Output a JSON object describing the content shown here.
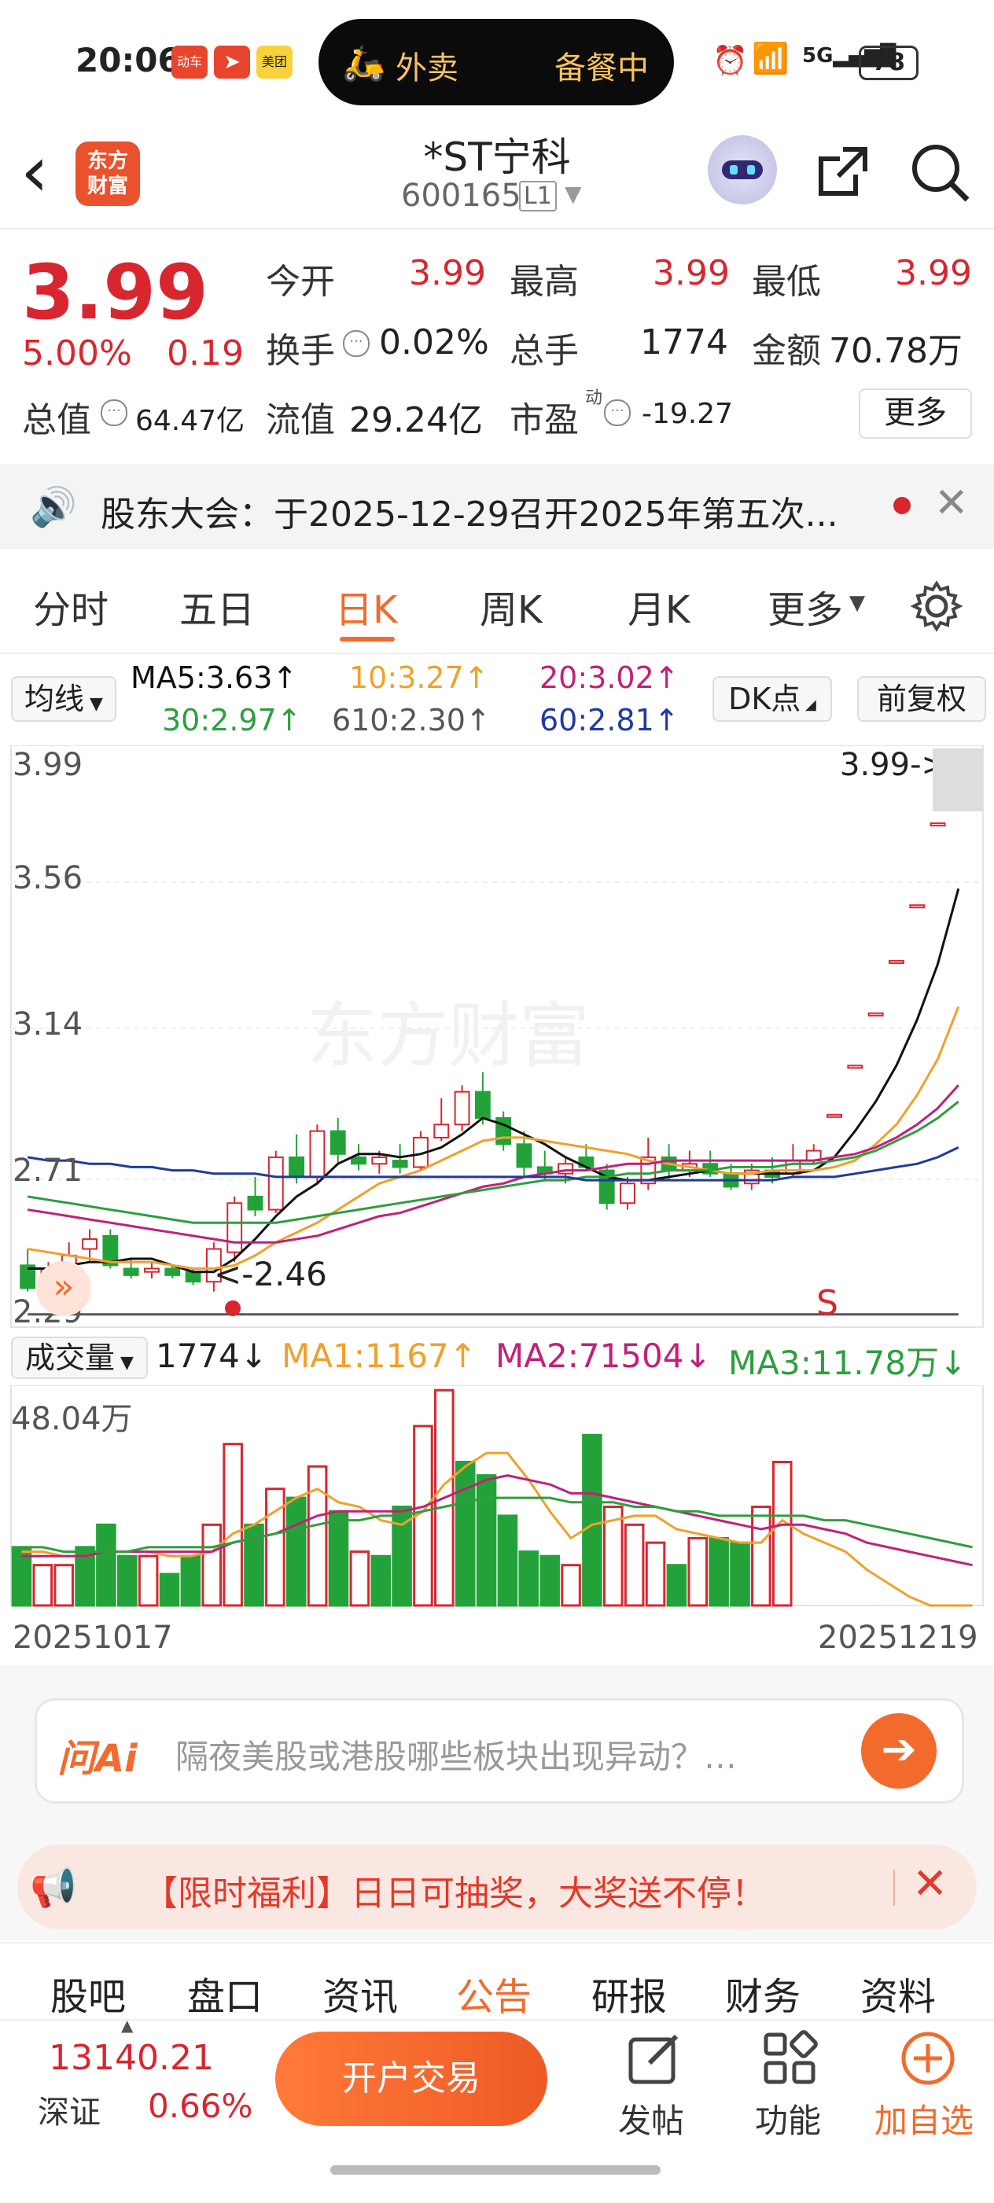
{
  "status": {
    "time": "20:06",
    "pill_left": "外卖",
    "pill_right": "备餐中",
    "battery": "78",
    "app_badges": [
      "动车",
      "",
      "美团"
    ]
  },
  "header": {
    "logo_text": "东方\n财富",
    "title": "*ST宁科",
    "code": "600165",
    "level": "L1"
  },
  "quote": {
    "price": "3.99",
    "change_pct": "5.00%",
    "change": "0.19",
    "open_label": "今开",
    "open": "3.99",
    "high_label": "最高",
    "high": "3.99",
    "low_label": "最低",
    "low": "3.99",
    "turnover_label": "换手",
    "turnover": "0.02%",
    "vol_label": "总手",
    "vol": "1774",
    "amount_label": "金额",
    "amount": "70.78万",
    "mktcap_label": "总值",
    "mktcap": "64.47亿",
    "float_label": "流值",
    "float_cap": "29.24亿",
    "pe_label": "市盈",
    "pe_sup": "动",
    "pe": "-19.27",
    "more": "更多"
  },
  "notice": {
    "text": "股东大会：于2025-12-29召开2025年第五次..."
  },
  "tabs": [
    "分时",
    "五日",
    "日K",
    "周K",
    "月K",
    "更多"
  ],
  "active_tab": "日K",
  "ma": {
    "chip": "均线",
    "ma5": "MA5:3.63↑",
    "ma10": "10:3.27↑",
    "ma20": "20:3.02↑",
    "ma30": "30:2.97↑",
    "ma610": "610:2.30↑",
    "ma60": "60:2.81↑",
    "dk": "DK点",
    "adj": "前复权"
  },
  "price_axis": [
    "3.99",
    "3.56",
    "3.14",
    "2.71",
    "2.29"
  ],
  "price_tag": "3.99->",
  "low_tag": "<-2.46",
  "signal": "S",
  "volume": {
    "chip": "成交量",
    "value": "1774↓",
    "ma1": "MA1:1167↑",
    "ma2": "MA2:71504↓",
    "ma3": "MA3:11.78万↓",
    "max_label": "48.04万"
  },
  "dates": {
    "start": "20251017",
    "end": "20251219"
  },
  "ai": {
    "placeholder": "隔夜美股或港股哪些板块出现异动？…",
    "logo": "问Ai"
  },
  "promo": {
    "text": "【限时福利】日日可抽奖，大奖送不停！"
  },
  "bottom_tabs": [
    "股吧",
    "盘口",
    "资讯",
    "公告",
    "研报",
    "财务",
    "资料"
  ],
  "active_bottom": "公告",
  "footer": {
    "index_value": "13140.21",
    "index_name": "深证",
    "index_change": "0.66%",
    "trade_button": "开户交易",
    "post": "发帖",
    "function": "功能",
    "add_watch": "加自选"
  },
  "colors": {
    "up": "#d8262f",
    "down": "#24a23a",
    "accent": "#f26b2c"
  },
  "chart_data": [
    {
      "type": "candlestick",
      "x_start": "20251017",
      "x_end": "20251219",
      "ylim": [
        2.29,
        3.99
      ],
      "y_ticks": [
        3.99,
        3.56,
        3.14,
        2.71,
        2.29
      ],
      "candles": [
        {
          "o": 2.45,
          "h": 2.5,
          "l": 2.37,
          "c": 2.38
        },
        {
          "o": 2.4,
          "h": 2.46,
          "l": 2.38,
          "c": 2.44
        },
        {
          "o": 2.42,
          "h": 2.52,
          "l": 2.39,
          "c": 2.48
        },
        {
          "o": 2.5,
          "h": 2.56,
          "l": 2.46,
          "c": 2.53
        },
        {
          "o": 2.54,
          "h": 2.56,
          "l": 2.44,
          "c": 2.45
        },
        {
          "o": 2.44,
          "h": 2.47,
          "l": 2.41,
          "c": 2.42
        },
        {
          "o": 2.43,
          "h": 2.46,
          "l": 2.41,
          "c": 2.44
        },
        {
          "o": 2.44,
          "h": 2.45,
          "l": 2.41,
          "c": 2.42
        },
        {
          "o": 2.43,
          "h": 2.44,
          "l": 2.39,
          "c": 2.4
        },
        {
          "o": 2.4,
          "h": 2.52,
          "l": 2.37,
          "c": 2.5
        },
        {
          "o": 2.49,
          "h": 2.66,
          "l": 2.46,
          "c": 2.64
        },
        {
          "o": 2.66,
          "h": 2.72,
          "l": 2.6,
          "c": 2.62
        },
        {
          "o": 2.62,
          "h": 2.8,
          "l": 2.61,
          "c": 2.78
        },
        {
          "o": 2.78,
          "h": 2.85,
          "l": 2.7,
          "c": 2.72
        },
        {
          "o": 2.72,
          "h": 2.88,
          "l": 2.7,
          "c": 2.86
        },
        {
          "o": 2.86,
          "h": 2.9,
          "l": 2.76,
          "c": 2.79
        },
        {
          "o": 2.78,
          "h": 2.82,
          "l": 2.74,
          "c": 2.76
        },
        {
          "o": 2.76,
          "h": 2.8,
          "l": 2.73,
          "c": 2.78
        },
        {
          "o": 2.77,
          "h": 2.82,
          "l": 2.73,
          "c": 2.75
        },
        {
          "o": 2.75,
          "h": 2.86,
          "l": 2.74,
          "c": 2.84
        },
        {
          "o": 2.84,
          "h": 2.96,
          "l": 2.83,
          "c": 2.88
        },
        {
          "o": 2.88,
          "h": 3.0,
          "l": 2.86,
          "c": 2.98
        },
        {
          "o": 2.98,
          "h": 3.04,
          "l": 2.88,
          "c": 2.9
        },
        {
          "o": 2.9,
          "h": 2.92,
          "l": 2.8,
          "c": 2.82
        },
        {
          "o": 2.82,
          "h": 2.86,
          "l": 2.72,
          "c": 2.75
        },
        {
          "o": 2.75,
          "h": 2.8,
          "l": 2.71,
          "c": 2.73
        },
        {
          "o": 2.73,
          "h": 2.78,
          "l": 2.7,
          "c": 2.76
        },
        {
          "o": 2.78,
          "h": 2.82,
          "l": 2.74,
          "c": 2.75
        },
        {
          "o": 2.74,
          "h": 2.76,
          "l": 2.62,
          "c": 2.64
        },
        {
          "o": 2.64,
          "h": 2.72,
          "l": 2.62,
          "c": 2.7
        },
        {
          "o": 2.7,
          "h": 2.84,
          "l": 2.68,
          "c": 2.78
        },
        {
          "o": 2.78,
          "h": 2.82,
          "l": 2.71,
          "c": 2.74
        },
        {
          "o": 2.74,
          "h": 2.8,
          "l": 2.72,
          "c": 2.76
        },
        {
          "o": 2.76,
          "h": 2.8,
          "l": 2.72,
          "c": 2.73
        },
        {
          "o": 2.73,
          "h": 2.76,
          "l": 2.68,
          "c": 2.69
        },
        {
          "o": 2.7,
          "h": 2.76,
          "l": 2.68,
          "c": 2.74
        },
        {
          "o": 2.74,
          "h": 2.78,
          "l": 2.7,
          "c": 2.72
        },
        {
          "o": 2.73,
          "h": 2.82,
          "l": 2.72,
          "c": 2.77
        },
        {
          "o": 2.77,
          "h": 2.82,
          "l": 2.76,
          "c": 2.8
        },
        {
          "o": 2.91,
          "h": 2.91,
          "l": 2.91,
          "c": 2.91
        },
        {
          "o": 3.06,
          "h": 3.06,
          "l": 3.06,
          "c": 3.06
        },
        {
          "o": 3.22,
          "h": 3.22,
          "l": 3.22,
          "c": 3.22
        },
        {
          "o": 3.38,
          "h": 3.38,
          "l": 3.38,
          "c": 3.38
        },
        {
          "o": 3.55,
          "h": 3.55,
          "l": 3.55,
          "c": 3.55
        },
        {
          "o": 3.8,
          "h": 3.8,
          "l": 3.8,
          "c": 3.8
        },
        {
          "o": 3.99,
          "h": 3.99,
          "l": 3.99,
          "c": 3.99
        }
      ],
      "series": [
        {
          "name": "MA5",
          "color": "#111111",
          "values": [
            2.44,
            2.44,
            2.45,
            2.46,
            2.46,
            2.47,
            2.47,
            2.45,
            2.43,
            2.43,
            2.47,
            2.53,
            2.6,
            2.66,
            2.7,
            2.76,
            2.79,
            2.79,
            2.78,
            2.79,
            2.81,
            2.85,
            2.9,
            2.88,
            2.85,
            2.82,
            2.78,
            2.75,
            2.72,
            2.71,
            2.71,
            2.72,
            2.73,
            2.74,
            2.73,
            2.73,
            2.73,
            2.73,
            2.74,
            2.78,
            2.86,
            2.95,
            3.06,
            3.2,
            3.37,
            3.6
          ]
        },
        {
          "name": "10",
          "color": "#f0a02c",
          "values": [
            2.5,
            2.49,
            2.48,
            2.47,
            2.46,
            2.46,
            2.46,
            2.45,
            2.44,
            2.44,
            2.45,
            2.48,
            2.52,
            2.55,
            2.58,
            2.62,
            2.66,
            2.7,
            2.72,
            2.74,
            2.77,
            2.8,
            2.83,
            2.84,
            2.84,
            2.83,
            2.82,
            2.81,
            2.8,
            2.79,
            2.77,
            2.76,
            2.75,
            2.74,
            2.73,
            2.73,
            2.74,
            2.74,
            2.74,
            2.75,
            2.77,
            2.82,
            2.88,
            2.97,
            3.08,
            3.24
          ]
        },
        {
          "name": "20",
          "color": "#c2207a",
          "values": [
            2.62,
            2.61,
            2.6,
            2.59,
            2.58,
            2.57,
            2.56,
            2.55,
            2.54,
            2.53,
            2.52,
            2.52,
            2.52,
            2.53,
            2.54,
            2.56,
            2.58,
            2.6,
            2.61,
            2.63,
            2.65,
            2.67,
            2.69,
            2.7,
            2.72,
            2.73,
            2.74,
            2.74,
            2.75,
            2.76,
            2.76,
            2.77,
            2.77,
            2.77,
            2.77,
            2.77,
            2.77,
            2.77,
            2.77,
            2.78,
            2.79,
            2.81,
            2.84,
            2.88,
            2.93,
            3.0
          ]
        },
        {
          "name": "30",
          "color": "#2e9e3e",
          "values": [
            2.66,
            2.65,
            2.64,
            2.63,
            2.62,
            2.61,
            2.6,
            2.59,
            2.58,
            2.58,
            2.58,
            2.58,
            2.58,
            2.59,
            2.6,
            2.61,
            2.62,
            2.63,
            2.64,
            2.65,
            2.66,
            2.67,
            2.68,
            2.69,
            2.7,
            2.71,
            2.71,
            2.72,
            2.72,
            2.73,
            2.73,
            2.74,
            2.74,
            2.74,
            2.75,
            2.75,
            2.75,
            2.76,
            2.76,
            2.77,
            2.78,
            2.8,
            2.83,
            2.86,
            2.9,
            2.95
          ]
        },
        {
          "name": "60",
          "color": "#203a9e",
          "values": [
            2.78,
            2.77,
            2.77,
            2.76,
            2.76,
            2.75,
            2.75,
            2.74,
            2.74,
            2.73,
            2.73,
            2.73,
            2.72,
            2.72,
            2.72,
            2.72,
            2.72,
            2.72,
            2.72,
            2.72,
            2.72,
            2.72,
            2.72,
            2.72,
            2.72,
            2.72,
            2.72,
            2.71,
            2.71,
            2.71,
            2.71,
            2.71,
            2.71,
            2.71,
            2.71,
            2.71,
            2.71,
            2.72,
            2.72,
            2.72,
            2.73,
            2.74,
            2.75,
            2.76,
            2.78,
            2.81
          ]
        },
        {
          "name": "610",
          "color": "#555555",
          "values": [
            2.3,
            2.3,
            2.3,
            2.3,
            2.3,
            2.3,
            2.3,
            2.3,
            2.3,
            2.3,
            2.3,
            2.3,
            2.3,
            2.3,
            2.3,
            2.3,
            2.3,
            2.3,
            2.3,
            2.3,
            2.3,
            2.3,
            2.3,
            2.3,
            2.3,
            2.3,
            2.3,
            2.3,
            2.3,
            2.3,
            2.3,
            2.3,
            2.3,
            2.3,
            2.3,
            2.3,
            2.3,
            2.3,
            2.3,
            2.3,
            2.3,
            2.3,
            2.3,
            2.3,
            2.3,
            2.3
          ]
        }
      ]
    },
    {
      "type": "bar",
      "ymax": 48.04,
      "unit": "万",
      "values": [
        13,
        9,
        9,
        13,
        18,
        11,
        11,
        7,
        11,
        18,
        36,
        18,
        26,
        24,
        31,
        21,
        12,
        11,
        22,
        40,
        48,
        32,
        29,
        20,
        12,
        11,
        9,
        38,
        22,
        18,
        14,
        9,
        15,
        15,
        14,
        22,
        32,
        0,
        0,
        0,
        0,
        0,
        0,
        0,
        0,
        0
      ],
      "ups": [
        false,
        true,
        true,
        false,
        false,
        false,
        true,
        false,
        false,
        true,
        true,
        false,
        true,
        false,
        true,
        false,
        true,
        false,
        false,
        true,
        true,
        false,
        false,
        false,
        false,
        false,
        true,
        false,
        true,
        true,
        true,
        false,
        true,
        false,
        false,
        true,
        true,
        true,
        true,
        true,
        true,
        true,
        true,
        true,
        true,
        true
      ],
      "series": [
        {
          "name": "MA1",
          "color": "#f0a02c",
          "values": [
            12,
            12,
            11,
            11,
            12,
            12,
            12,
            11,
            11,
            12,
            16,
            18,
            21,
            24,
            26,
            23,
            22,
            19,
            18,
            21,
            27,
            31,
            34,
            34,
            28,
            21,
            15,
            18,
            19,
            20,
            20,
            17,
            16,
            15,
            14,
            14,
            19,
            16,
            14,
            12,
            8,
            5,
            2,
            0,
            0,
            0
          ]
        },
        {
          "name": "MA2",
          "color": "#c2207a",
          "values": [
            11,
            11,
            11,
            11,
            12,
            12,
            12,
            12,
            12,
            12,
            14,
            15,
            16,
            18,
            20,
            21,
            21,
            21,
            21,
            22,
            24,
            26,
            28,
            29,
            28,
            27,
            25,
            25,
            24,
            23,
            22,
            21,
            20,
            19,
            18,
            17,
            18,
            18,
            17,
            16,
            14,
            13,
            12,
            11,
            10,
            9
          ]
        },
        {
          "name": "MA3",
          "color": "#2e9e3e",
          "values": [
            13,
            13,
            12,
            12,
            12,
            12,
            13,
            13,
            13,
            13,
            14,
            15,
            16,
            17,
            18,
            19,
            19,
            20,
            20,
            21,
            22,
            23,
            24,
            24,
            24,
            24,
            23,
            23,
            23,
            22,
            22,
            21,
            21,
            20,
            20,
            20,
            20,
            20,
            19,
            19,
            18,
            17,
            16,
            15,
            14,
            13
          ]
        }
      ]
    }
  ]
}
